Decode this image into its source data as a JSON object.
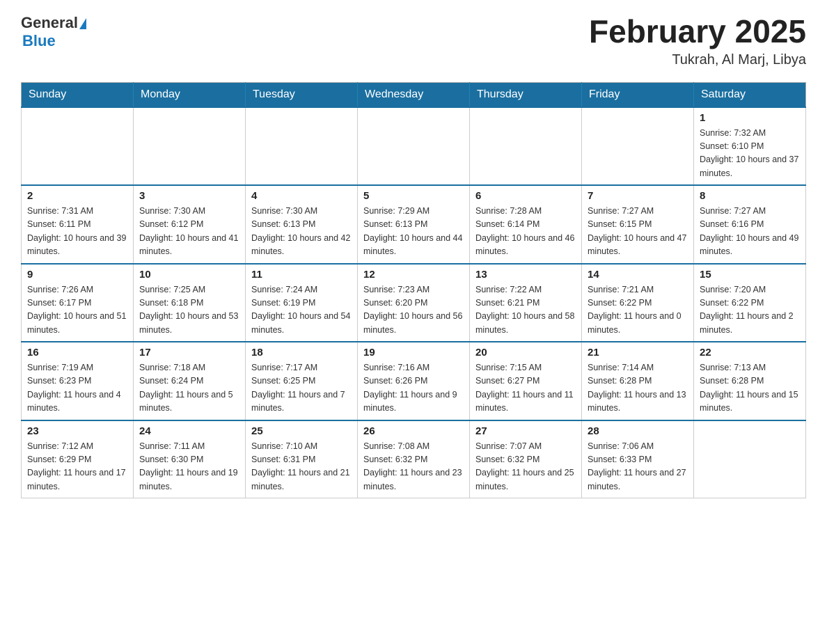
{
  "header": {
    "logo_general": "General",
    "logo_blue": "Blue",
    "month_title": "February 2025",
    "location": "Tukrah, Al Marj, Libya"
  },
  "days_of_week": [
    "Sunday",
    "Monday",
    "Tuesday",
    "Wednesday",
    "Thursday",
    "Friday",
    "Saturday"
  ],
  "weeks": [
    [
      {
        "day": "",
        "info": ""
      },
      {
        "day": "",
        "info": ""
      },
      {
        "day": "",
        "info": ""
      },
      {
        "day": "",
        "info": ""
      },
      {
        "day": "",
        "info": ""
      },
      {
        "day": "",
        "info": ""
      },
      {
        "day": "1",
        "info": "Sunrise: 7:32 AM\nSunset: 6:10 PM\nDaylight: 10 hours and 37 minutes."
      }
    ],
    [
      {
        "day": "2",
        "info": "Sunrise: 7:31 AM\nSunset: 6:11 PM\nDaylight: 10 hours and 39 minutes."
      },
      {
        "day": "3",
        "info": "Sunrise: 7:30 AM\nSunset: 6:12 PM\nDaylight: 10 hours and 41 minutes."
      },
      {
        "day": "4",
        "info": "Sunrise: 7:30 AM\nSunset: 6:13 PM\nDaylight: 10 hours and 42 minutes."
      },
      {
        "day": "5",
        "info": "Sunrise: 7:29 AM\nSunset: 6:13 PM\nDaylight: 10 hours and 44 minutes."
      },
      {
        "day": "6",
        "info": "Sunrise: 7:28 AM\nSunset: 6:14 PM\nDaylight: 10 hours and 46 minutes."
      },
      {
        "day": "7",
        "info": "Sunrise: 7:27 AM\nSunset: 6:15 PM\nDaylight: 10 hours and 47 minutes."
      },
      {
        "day": "8",
        "info": "Sunrise: 7:27 AM\nSunset: 6:16 PM\nDaylight: 10 hours and 49 minutes."
      }
    ],
    [
      {
        "day": "9",
        "info": "Sunrise: 7:26 AM\nSunset: 6:17 PM\nDaylight: 10 hours and 51 minutes."
      },
      {
        "day": "10",
        "info": "Sunrise: 7:25 AM\nSunset: 6:18 PM\nDaylight: 10 hours and 53 minutes."
      },
      {
        "day": "11",
        "info": "Sunrise: 7:24 AM\nSunset: 6:19 PM\nDaylight: 10 hours and 54 minutes."
      },
      {
        "day": "12",
        "info": "Sunrise: 7:23 AM\nSunset: 6:20 PM\nDaylight: 10 hours and 56 minutes."
      },
      {
        "day": "13",
        "info": "Sunrise: 7:22 AM\nSunset: 6:21 PM\nDaylight: 10 hours and 58 minutes."
      },
      {
        "day": "14",
        "info": "Sunrise: 7:21 AM\nSunset: 6:22 PM\nDaylight: 11 hours and 0 minutes."
      },
      {
        "day": "15",
        "info": "Sunrise: 7:20 AM\nSunset: 6:22 PM\nDaylight: 11 hours and 2 minutes."
      }
    ],
    [
      {
        "day": "16",
        "info": "Sunrise: 7:19 AM\nSunset: 6:23 PM\nDaylight: 11 hours and 4 minutes."
      },
      {
        "day": "17",
        "info": "Sunrise: 7:18 AM\nSunset: 6:24 PM\nDaylight: 11 hours and 5 minutes."
      },
      {
        "day": "18",
        "info": "Sunrise: 7:17 AM\nSunset: 6:25 PM\nDaylight: 11 hours and 7 minutes."
      },
      {
        "day": "19",
        "info": "Sunrise: 7:16 AM\nSunset: 6:26 PM\nDaylight: 11 hours and 9 minutes."
      },
      {
        "day": "20",
        "info": "Sunrise: 7:15 AM\nSunset: 6:27 PM\nDaylight: 11 hours and 11 minutes."
      },
      {
        "day": "21",
        "info": "Sunrise: 7:14 AM\nSunset: 6:28 PM\nDaylight: 11 hours and 13 minutes."
      },
      {
        "day": "22",
        "info": "Sunrise: 7:13 AM\nSunset: 6:28 PM\nDaylight: 11 hours and 15 minutes."
      }
    ],
    [
      {
        "day": "23",
        "info": "Sunrise: 7:12 AM\nSunset: 6:29 PM\nDaylight: 11 hours and 17 minutes."
      },
      {
        "day": "24",
        "info": "Sunrise: 7:11 AM\nSunset: 6:30 PM\nDaylight: 11 hours and 19 minutes."
      },
      {
        "day": "25",
        "info": "Sunrise: 7:10 AM\nSunset: 6:31 PM\nDaylight: 11 hours and 21 minutes."
      },
      {
        "day": "26",
        "info": "Sunrise: 7:08 AM\nSunset: 6:32 PM\nDaylight: 11 hours and 23 minutes."
      },
      {
        "day": "27",
        "info": "Sunrise: 7:07 AM\nSunset: 6:32 PM\nDaylight: 11 hours and 25 minutes."
      },
      {
        "day": "28",
        "info": "Sunrise: 7:06 AM\nSunset: 6:33 PM\nDaylight: 11 hours and 27 minutes."
      },
      {
        "day": "",
        "info": ""
      }
    ]
  ]
}
